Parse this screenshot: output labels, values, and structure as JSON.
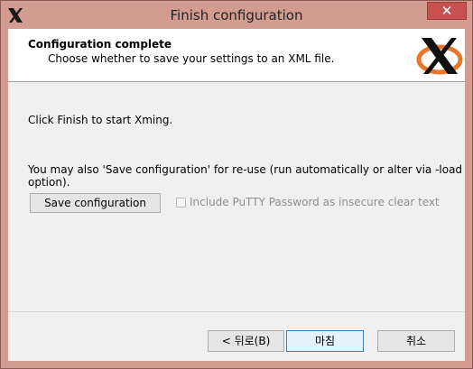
{
  "window": {
    "title": "Finish configuration",
    "close_glyph": "✕"
  },
  "header": {
    "title": "Configuration complete",
    "subtitle": "Choose whether to save your settings to an XML file."
  },
  "main": {
    "text_finish": "Click Finish to start Xming.",
    "text_save": "You may also 'Save configuration' for re-use (run automatically or alter via -load option).",
    "save_button_label": "Save configuration",
    "checkbox_label": "Include PuTTY Password as insecure clear text",
    "checkbox_checked": false,
    "checkbox_enabled": false
  },
  "footer": {
    "back_label": "< 뒤로(B)",
    "finish_label": "마침",
    "cancel_label": "취소"
  },
  "colors": {
    "titlebar": "#d29c91",
    "close_button": "#c75050",
    "client_bg": "#f0f0f0",
    "logo_orange": "#e8762b"
  },
  "icons": {
    "app": "xming-x-icon",
    "logo": "xming-logo"
  }
}
